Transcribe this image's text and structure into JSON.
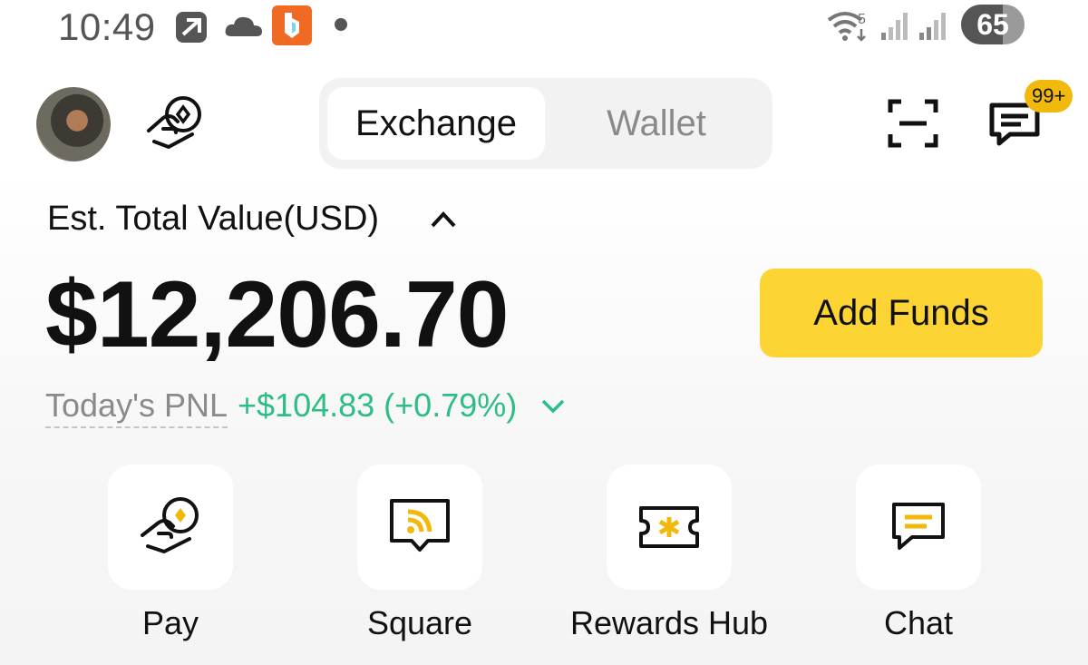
{
  "status_bar": {
    "time": "10:49",
    "battery": "65"
  },
  "header": {
    "tabs": [
      {
        "label": "Exchange",
        "active": true
      },
      {
        "label": "Wallet",
        "active": false
      }
    ],
    "notification_badge": "99+"
  },
  "balance": {
    "label": "Est. Total Value(USD)",
    "amount": "$12,206.70",
    "add_funds_label": "Add Funds",
    "pnl_label": "Today's PNL",
    "pnl_value": "+$104.83 (+0.79%)"
  },
  "quick_actions": [
    {
      "label": "Pay",
      "icon": "pay-icon"
    },
    {
      "label": "Square",
      "icon": "square-icon"
    },
    {
      "label": "Rewards Hub",
      "icon": "rewards-ticket-icon"
    },
    {
      "label": "Chat",
      "icon": "chat-icon"
    }
  ],
  "colors": {
    "accent": "#fcd535",
    "badge": "#f0b90b",
    "positive": "#2ebd85",
    "icon_yellow": "#f0b90b",
    "muted": "#8a8a8a"
  }
}
